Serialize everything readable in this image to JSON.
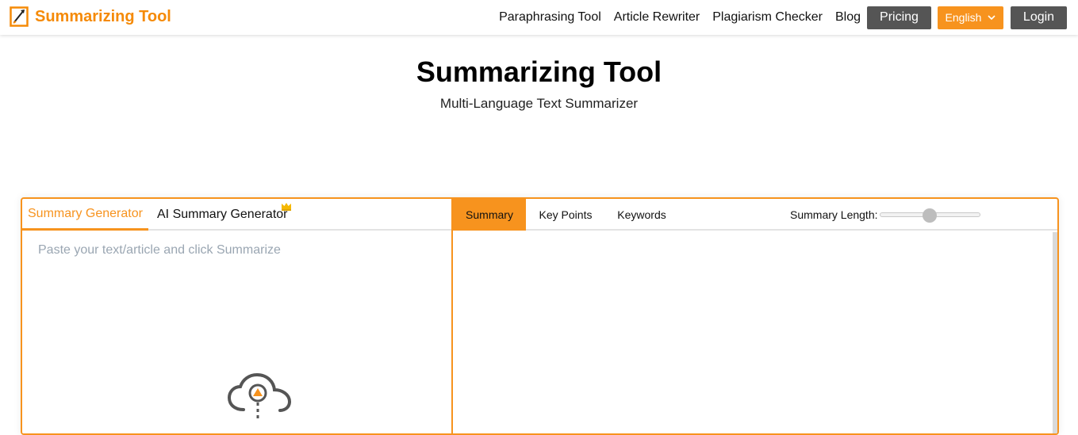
{
  "header": {
    "brand": "Summarizing Tool",
    "nav": [
      "Paraphrasing Tool",
      "Article Rewriter",
      "Plagiarism Checker",
      "Blog"
    ],
    "pricing": "Pricing",
    "language": "English",
    "login": "Login",
    "brand_color": "#f58a07"
  },
  "hero": {
    "title": "Summarizing Tool",
    "subtitle": "Multi-Language Text Summarizer"
  },
  "editor": {
    "tabs": [
      "Summary Generator",
      "AI Summary Generator"
    ],
    "active_tab": "Summary Generator",
    "input_value": "",
    "input_placeholder": "Paste your text/article and click Summarize",
    "upload_icon": "cloud-upload-icon",
    "premium_icon": "crown-icon"
  },
  "output": {
    "tabs": [
      "Summary",
      "Key Points",
      "Keywords"
    ],
    "active_tab": "Summary",
    "length_label": "Summary Length:",
    "length_value_pct": 50,
    "content": ""
  },
  "accent_color": "#f7931e"
}
